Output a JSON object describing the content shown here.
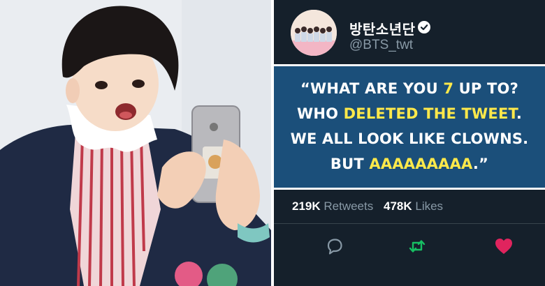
{
  "tweet": {
    "display_name": "방탄소년단",
    "handle": "@BTS_twt",
    "quote": {
      "line1_a": "“WHAT ARE YOU ",
      "line1_hl": "7",
      "line1_b": " UP TO?",
      "line2_a": "WHO ",
      "line2_hl": "DELETED THE TWEET",
      "line2_b": ".",
      "line3": "WE ALL LOOK LIKE CLOWNS.",
      "line4_a": "BUT ",
      "line4_hl": "AAAAAAAAA",
      "line4_b": ".”"
    },
    "stats": {
      "retweets_count": "219K",
      "retweets_label": "Retweets",
      "likes_count": "478K",
      "likes_label": "Likes"
    },
    "icons": {
      "verified": "verified-badge-icon",
      "reply": "reply-icon",
      "retweet": "retweet-icon",
      "like": "heart-icon"
    },
    "colors": {
      "background": "#15202b",
      "quote_box": "#1b4f7a",
      "highlight": "#ffe94a",
      "retweet": "#17bf63",
      "like": "#e0245e",
      "secondary_text": "#8899a6"
    }
  }
}
